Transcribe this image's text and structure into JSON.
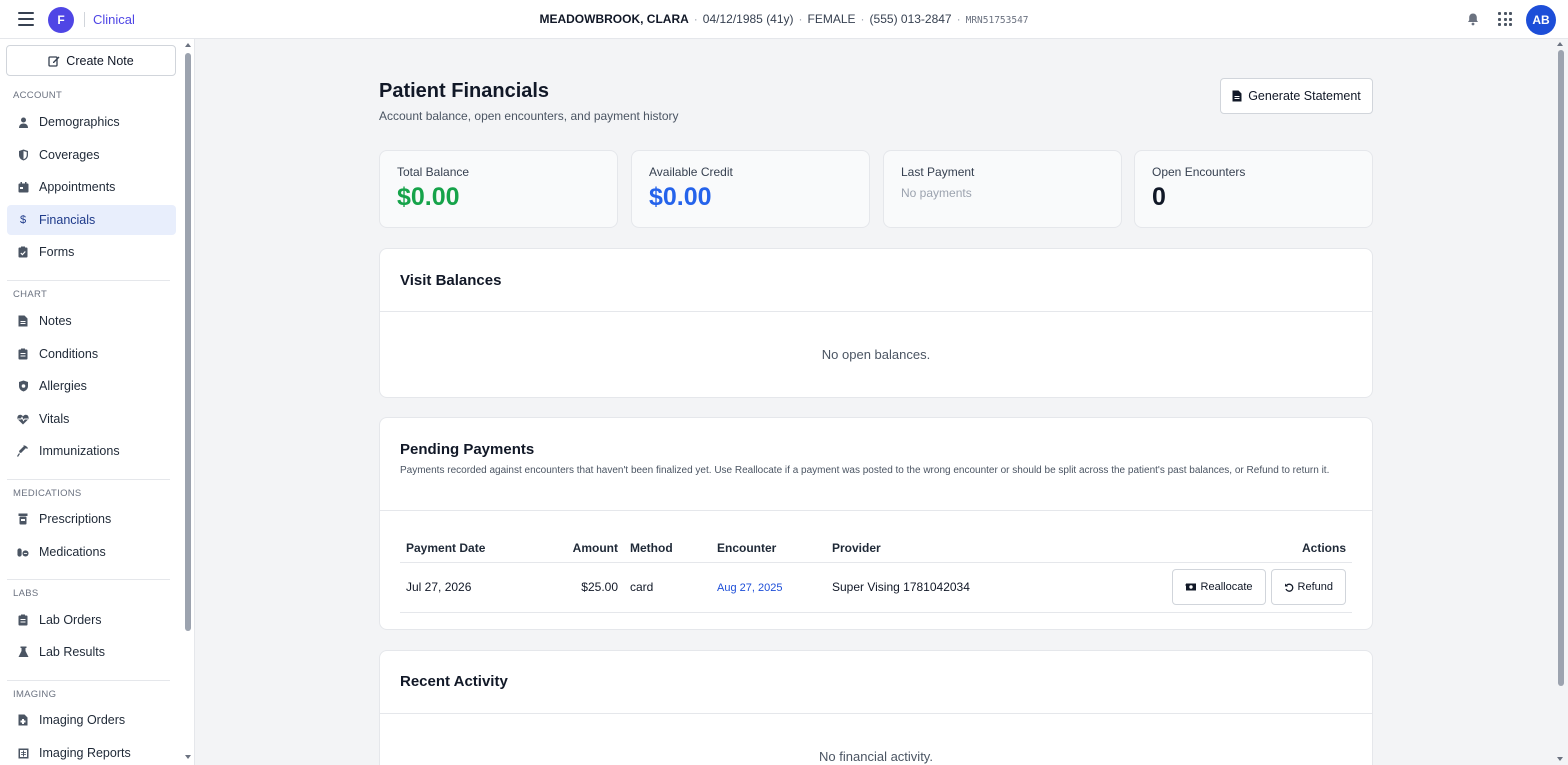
{
  "app": {
    "logo_letter": "F",
    "name": "Clinical"
  },
  "patient": {
    "name": "MEADOWBROOK, CLARA",
    "dob": "04/12/1985 (41y)",
    "sex": "FEMALE",
    "phone": "(555) 013-2847",
    "mrn": "MRN51753547"
  },
  "header": {
    "avatar_initials": "AB",
    "icons": [
      "bell-icon",
      "apps-grid-icon"
    ]
  },
  "sidebar": {
    "create_note": "Create Note",
    "sections": {
      "account": "ACCOUNT",
      "chart": "CHART",
      "medications": "MEDICATIONS",
      "labs": "LABS",
      "imaging": "IMAGING"
    },
    "items": {
      "demographics": "Demographics",
      "coverages": "Coverages",
      "appointments": "Appointments",
      "financials": "Financials",
      "forms": "Forms",
      "notes": "Notes",
      "conditions": "Conditions",
      "allergies": "Allergies",
      "vitals": "Vitals",
      "immunizations": "Immunizations",
      "prescriptions": "Prescriptions",
      "medications": "Medications",
      "lab_orders": "Lab Orders",
      "lab_results": "Lab Results",
      "imaging_orders": "Imaging Orders",
      "imaging_reports": "Imaging Reports"
    },
    "active": "Financials"
  },
  "page": {
    "title": "Patient Financials",
    "subtitle": "Account balance, open encounters, and payment history",
    "generate_statement": "Generate Statement"
  },
  "stats": {
    "total_balance": {
      "label": "Total Balance",
      "value": "$0.00",
      "color": "#16a34a"
    },
    "available_credit": {
      "label": "Available Credit",
      "value": "$0.00",
      "color": "#2563eb"
    },
    "last_payment": {
      "label": "Last Payment",
      "value": "No payments"
    },
    "open_encounters": {
      "label": "Open Encounters",
      "value": "0",
      "color": "#111827"
    }
  },
  "visit_balances": {
    "title": "Visit Balances",
    "empty": "No open balances."
  },
  "pending_payments": {
    "title": "Pending Payments",
    "description": "Payments recorded against encounters that haven't been finalized yet. Use Reallocate if a payment was posted to the wrong encounter or should be split across the patient's past balances, or Refund to return it.",
    "columns": {
      "date": "Payment Date",
      "amount": "Amount",
      "method": "Method",
      "encounter": "Encounter",
      "provider": "Provider",
      "actions": "Actions"
    },
    "rows": [
      {
        "date": "Jul 27, 2026",
        "amount": "$25.00",
        "method": "card",
        "encounter": "Aug 27, 2025",
        "provider": "Super Vising 1781042034",
        "reallocate": "Reallocate",
        "refund": "Refund"
      }
    ]
  },
  "recent_activity": {
    "title": "Recent Activity",
    "empty": "No financial activity."
  }
}
